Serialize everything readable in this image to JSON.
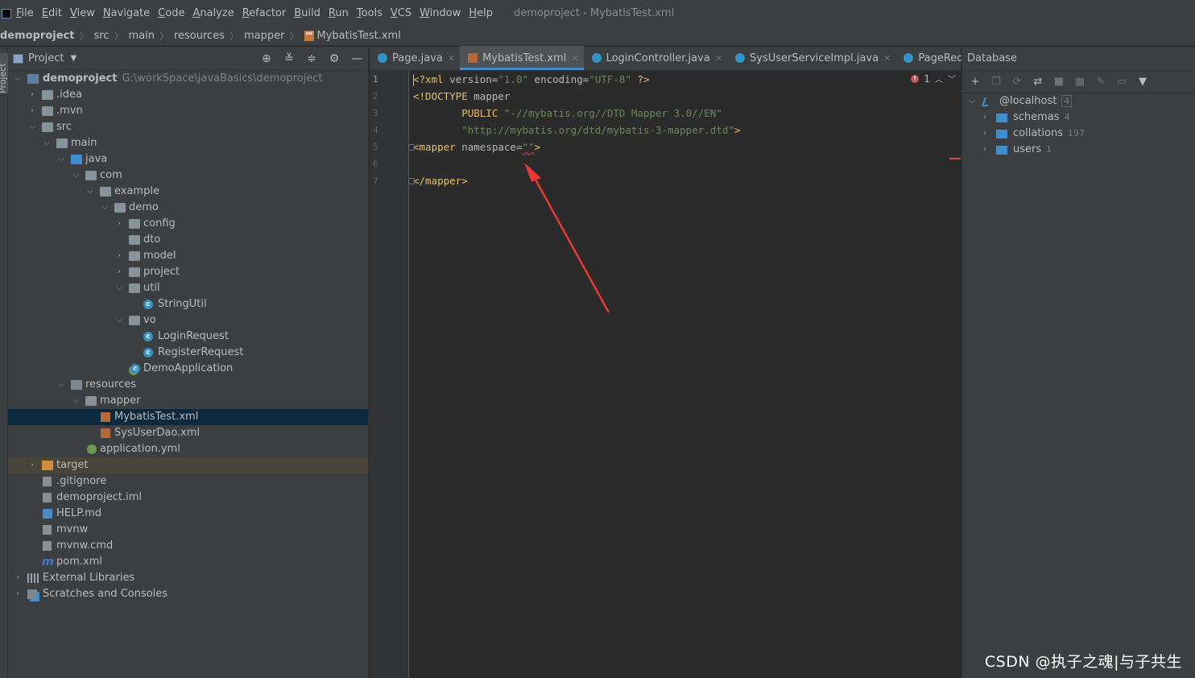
{
  "menubar": {
    "items": [
      "File",
      "Edit",
      "View",
      "Navigate",
      "Code",
      "Analyze",
      "Refactor",
      "Build",
      "Run",
      "Tools",
      "VCS",
      "Window",
      "Help"
    ],
    "window_title": "demoproject - MybatisTest.xml"
  },
  "breadcrumb": {
    "items": [
      "demoproject",
      "src",
      "main",
      "resources",
      "mapper",
      "MybatisTest.xml"
    ]
  },
  "left_stripe": {
    "label": "Project"
  },
  "project_panel": {
    "title": "Project",
    "tree": [
      {
        "label": "demoproject",
        "path": "G:\\workSpace\\javaBasics\\demoproject"
      },
      {
        "label": ".idea"
      },
      {
        "label": ".mvn"
      },
      {
        "label": "src"
      },
      {
        "label": "main"
      },
      {
        "label": "java"
      },
      {
        "label": "com"
      },
      {
        "label": "example"
      },
      {
        "label": "demo"
      },
      {
        "label": "config"
      },
      {
        "label": "dto"
      },
      {
        "label": "model"
      },
      {
        "label": "project"
      },
      {
        "label": "util"
      },
      {
        "label": "StringUtil"
      },
      {
        "label": "vo"
      },
      {
        "label": "LoginRequest"
      },
      {
        "label": "RegisterRequest"
      },
      {
        "label": "DemoApplication"
      },
      {
        "label": "resources"
      },
      {
        "label": "mapper"
      },
      {
        "label": "MybatisTest.xml"
      },
      {
        "label": "SysUserDao.xml"
      },
      {
        "label": "application.yml"
      },
      {
        "label": "target"
      },
      {
        "label": ".gitignore"
      },
      {
        "label": "demoproject.iml"
      },
      {
        "label": "HELP.md"
      },
      {
        "label": "mvnw"
      },
      {
        "label": "mvnw.cmd"
      },
      {
        "label": "pom.xml"
      },
      {
        "label": "External Libraries"
      },
      {
        "label": "Scratches and Consoles"
      }
    ]
  },
  "editor": {
    "tabs": [
      {
        "label": "Page.java"
      },
      {
        "label": "MybatisTest.xml"
      },
      {
        "label": "LoginController.java"
      },
      {
        "label": "SysUserServiceImpl.java"
      },
      {
        "label": "PageRequest"
      }
    ],
    "line_numbers": [
      "1",
      "2",
      "3",
      "4",
      "5",
      "6",
      "7"
    ],
    "code": {
      "l1": {
        "a": "<?xml ",
        "b": "version",
        "c": "=",
        "d": "\"1.0\"",
        "e": " ",
        "f": "encoding",
        "g": "=",
        "h": "\"UTF-8\"",
        "i": " ?>"
      },
      "l2": {
        "a": "<!DOCTYPE ",
        "b": "mapper"
      },
      "l3": {
        "a": "        PUBLIC ",
        "b": "\"-//mybatis.org//DTD Mapper 3.0//EN\""
      },
      "l4": {
        "a": "        ",
        "b": "\"http://mybatis.org/dtd/mybatis-3-mapper.dtd\"",
        "c": ">"
      },
      "l5": {
        "a": "<mapper ",
        "b": "namespace",
        "c": "=",
        "d": "\"\"",
        "e": ">"
      },
      "l7": {
        "a": "</mapper>"
      }
    },
    "inspection": {
      "errors": "1"
    }
  },
  "database_panel": {
    "title": "Database",
    "tree": [
      {
        "label": "@localhost",
        "count": "4"
      },
      {
        "label": "schemas",
        "count": "4"
      },
      {
        "label": "collations",
        "count": "197"
      },
      {
        "label": "users",
        "count": "1"
      }
    ]
  },
  "watermark": "CSDN @执子之魂|与子共生",
  "colors": {
    "background": "#2b2b2b",
    "panel": "#3c3f41",
    "selection": "#0d293e",
    "accent": "#4a88c7",
    "error": "#c75450",
    "annotation_arrow": "#e53935"
  }
}
